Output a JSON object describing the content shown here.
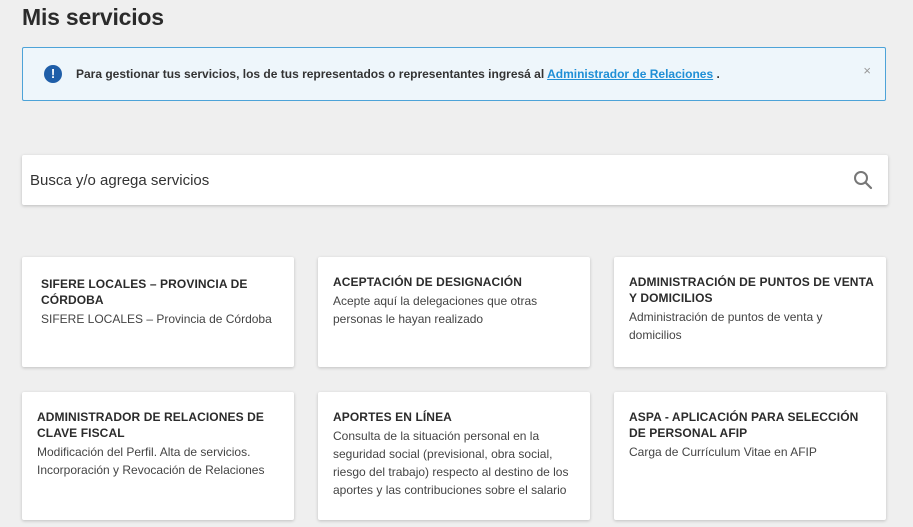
{
  "page": {
    "title": "Mis servicios"
  },
  "alert": {
    "text": "Para gestionar tus servicios, los de tus representados o representantes ingresá al",
    "link": "Administrador de Relaciones",
    "suffix": ".",
    "close": "×",
    "icon": "info-icon"
  },
  "search": {
    "placeholder": "Busca y/o agrega servicios",
    "icon": "search-icon"
  },
  "cards": [
    {
      "title": "SIFERE LOCALES – PROVINCIA DE CÓRDOBA",
      "desc": "SIFERE LOCALES – Provincia de Córdoba"
    },
    {
      "title": "ACEPTACIÓN DE DESIGNACIÓN",
      "desc": "Acepte aquí la delegaciones que otras personas le hayan realizado"
    },
    {
      "title": "ADMINISTRACIÓN DE PUNTOS DE VENTA Y DOMICILIOS",
      "desc": "Administración de puntos de venta y domicilios"
    },
    {
      "title": "ADMINISTRADOR DE RELACIONES DE CLAVE FISCAL",
      "desc": "Modificación del Perfil. Alta de servicios. Incorporación y Revocación de Relaciones"
    },
    {
      "title": "APORTES EN LÍNEA",
      "desc": "Consulta de la situación personal en la seguridad social (previsional, obra social, riesgo del trabajo) respecto al destino de los aportes y las contribuciones sobre el salario"
    },
    {
      "title": "ASPA - APLICACIÓN PARA SELECCIÓN DE PERSONAL AFIP",
      "desc": "Carga de Currículum Vitae en AFIP"
    }
  ],
  "colors": {
    "accent": "#1f8fd6",
    "info_icon": "#1f5ea8",
    "alert_bg": "#eef6fb",
    "alert_border": "#4da3d8",
    "page_bg": "#efefef"
  }
}
